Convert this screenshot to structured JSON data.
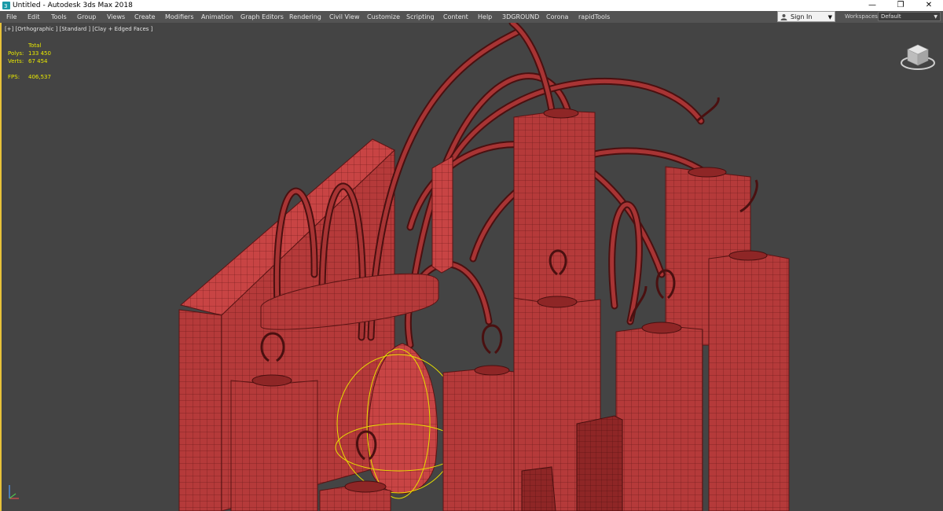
{
  "window": {
    "title": "Untitled - Autodesk 3ds Max 2018",
    "app_icon": "3ds-max-icon",
    "controls": {
      "minimize": "—",
      "restore": "❐",
      "close": "✕"
    }
  },
  "menu": {
    "items": [
      "File",
      "Edit",
      "Tools",
      "Group",
      "Views",
      "Create",
      "Modifiers",
      "Animation",
      "Graph Editors",
      "Rendering",
      "Civil View",
      "Customize",
      "Scripting",
      "Content",
      "Help",
      "3DGROUND",
      "Corona",
      "rapidTools"
    ]
  },
  "account": {
    "sign_in": "Sign In",
    "icon": "user-icon"
  },
  "workspace": {
    "label": "Workspaces:",
    "value": "Default"
  },
  "viewport": {
    "label": "[+] [Orthographic ] [Standard ] [Clay + Edged Faces ]",
    "stats": {
      "header": "Total",
      "polys_label": "Polys:",
      "polys_value": "133 450",
      "verts_label": "Verts:",
      "verts_value": "67 454",
      "fps_label": "FPS:",
      "fps_value": "406,537"
    },
    "colors": {
      "model": "#b53a3a",
      "model_dark": "#7a1f1f",
      "edges": "#5a1414",
      "selection": "#e8e000",
      "background": "#444444"
    }
  }
}
